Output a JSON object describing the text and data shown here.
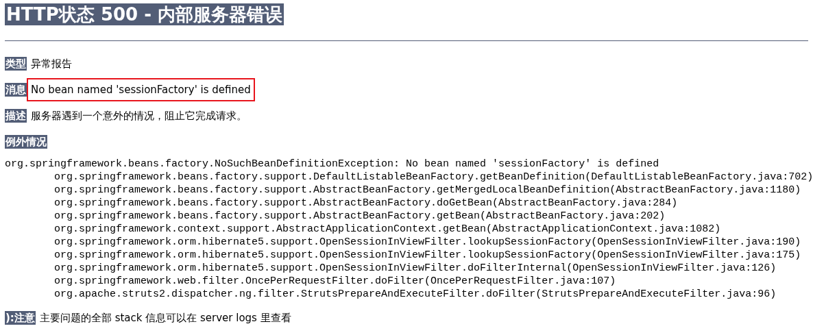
{
  "title": "HTTP状态 500 - 内部服务器错误",
  "fields": [
    {
      "label": "类型",
      "value": "异常报告",
      "highlighted": false
    },
    {
      "label": "消息",
      "value": "No bean named 'sessionFactory' is defined",
      "highlighted": true
    },
    {
      "label": "描述",
      "value": "服务器遇到一个意外的情况，阻止它完成请求。",
      "highlighted": false
    }
  ],
  "exception": {
    "label": "例外情况",
    "trace": [
      "org.springframework.beans.factory.NoSuchBeanDefinitionException: No bean named 'sessionFactory' is defined",
      "\torg.springframework.beans.factory.support.DefaultListableBeanFactory.getBeanDefinition(DefaultListableBeanFactory.java:702)",
      "\torg.springframework.beans.factory.support.AbstractBeanFactory.getMergedLocalBeanDefinition(AbstractBeanFactory.java:1180)",
      "\torg.springframework.beans.factory.support.AbstractBeanFactory.doGetBean(AbstractBeanFactory.java:284)",
      "\torg.springframework.beans.factory.support.AbstractBeanFactory.getBean(AbstractBeanFactory.java:202)",
      "\torg.springframework.context.support.AbstractApplicationContext.getBean(AbstractApplicationContext.java:1082)",
      "\torg.springframework.orm.hibernate5.support.OpenSessionInViewFilter.lookupSessionFactory(OpenSessionInViewFilter.java:190)",
      "\torg.springframework.orm.hibernate5.support.OpenSessionInViewFilter.lookupSessionFactory(OpenSessionInViewFilter.java:175)",
      "\torg.springframework.orm.hibernate5.support.OpenSessionInViewFilter.doFilterInternal(OpenSessionInViewFilter.java:126)",
      "\torg.springframework.web.filter.OncePerRequestFilter.doFilter(OncePerRequestFilter.java:107)",
      "\torg.apache.struts2.dispatcher.ng.filter.StrutsPrepareAndExecuteFilter.doFilter(StrutsPrepareAndExecuteFilter.java:96)"
    ]
  },
  "note": {
    "label": "):注意",
    "text": "主要问题的全部 stack 信息可以在 server logs 里查看"
  }
}
